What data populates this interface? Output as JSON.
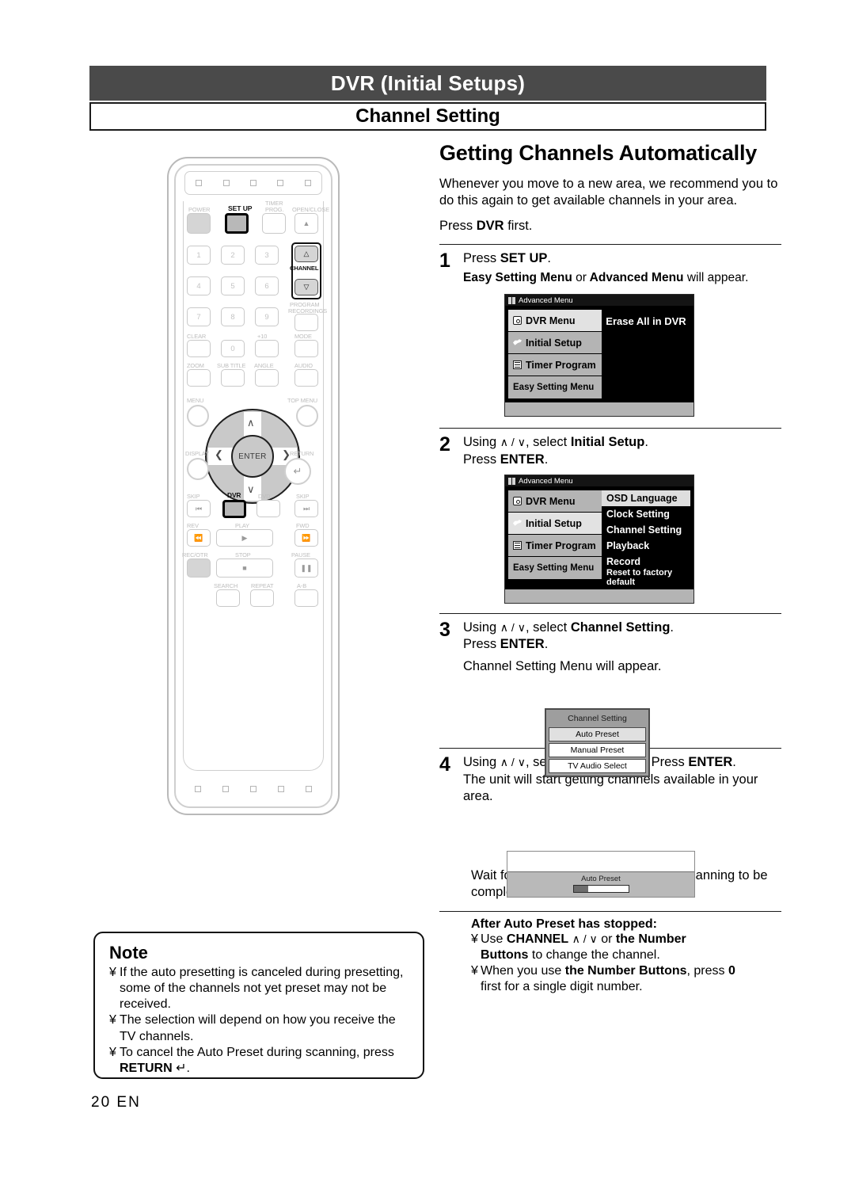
{
  "header": {
    "page_title": "DVR (Initial Setups)",
    "section_title": "Channel Setting"
  },
  "content": {
    "main_heading": "Getting Channels Automatically",
    "intro_1": "Whenever you move to a new area, we recommend you to do this again to get available channels in your area.",
    "intro_2_prefix": "Press ",
    "intro_2_bold": "DVR",
    "intro_2_suffix": " first.",
    "steps": [
      {
        "num": "1",
        "line1_pre": "Press ",
        "line1_bold": "SET UP",
        "line1_post": ".",
        "sub_a": "Easy Setting Menu",
        "sub_or": "or",
        "sub_b": "Advanced Menu",
        "sub_post": "will appear."
      },
      {
        "num": "2",
        "line1_pre": "Using ",
        "line1_keys": "∧ / ∨",
        "line1_mid": ", select ",
        "line1_bold": "Initial Setup",
        "line1_post": ".",
        "line2_pre": "Press ",
        "line2_bold": "ENTER",
        "line2_post": "."
      },
      {
        "num": "3",
        "line1_pre": "Using ",
        "line1_keys": "∧ / ∨",
        "line1_mid": ", select ",
        "line1_bold": "Channel Setting",
        "line1_post": ".",
        "line2_pre": "Press ",
        "line2_bold": "ENTER",
        "line2_post": ".",
        "line3": "Channel Setting Menu will appear."
      },
      {
        "num": "4",
        "line1_pre": "Using ",
        "line1_keys": "∧ / ∨",
        "line1_mid": ", select ",
        "line1_bold": "Auto Preset",
        "line1_mid2": ". Press ",
        "line1_bold2": "ENTER",
        "line1_post": ".",
        "line2": "The unit will start getting channels available in your area.",
        "line3": "Wait for several minutes for channel scanning to be completed."
      }
    ],
    "after": {
      "title": "After Auto Preset has stopped:",
      "b1_pre": "Use ",
      "b1_bold": "CHANNEL",
      "b1_keys": "∧ / ∨",
      "b1_mid": " or ",
      "b1_bold2": "the Number",
      "b1_bold3": "Buttons",
      "b1_post": " to change the channel.",
      "b2_pre": "When you use ",
      "b2_bold": "the Number Buttons",
      "b2_mid": ", press ",
      "b2_bold2": "0",
      "b2_post": "first for a single digit number."
    }
  },
  "osd_screens": {
    "advanced_menu_1": {
      "title": "Advanced Menu",
      "left_items": [
        {
          "label": "DVR Menu",
          "icon": "disc-icon",
          "selected": true
        },
        {
          "label": "Initial Setup",
          "icon": "wrench-icon",
          "selected": false
        },
        {
          "label": "Timer Program",
          "icon": "lines-icon",
          "selected": false
        },
        {
          "label": "Easy Setting Menu",
          "icon": "none",
          "selected": false
        }
      ],
      "right_items": [
        {
          "label": "Erase All in DVR",
          "selected": false
        }
      ]
    },
    "advanced_menu_2": {
      "title": "Advanced Menu",
      "left_items": [
        {
          "label": "DVR Menu",
          "icon": "disc-icon",
          "selected": false
        },
        {
          "label": "Initial Setup",
          "icon": "wrench-icon",
          "selected": true
        },
        {
          "label": "Timer Program",
          "icon": "lines-icon",
          "selected": false
        },
        {
          "label": "Easy Setting Menu",
          "icon": "none",
          "selected": false
        }
      ],
      "right_items": [
        {
          "label": "OSD Language",
          "selected": true
        },
        {
          "label": "Clock Setting",
          "selected": false
        },
        {
          "label": "Channel Setting",
          "selected": false
        },
        {
          "label": "Playback",
          "selected": false
        },
        {
          "label": "Record",
          "selected": false
        },
        {
          "label": "Reset to factory default",
          "selected": false
        }
      ]
    },
    "channel_setting_menu": {
      "title": "Channel Setting",
      "items": [
        {
          "label": "Auto Preset",
          "selected": true
        },
        {
          "label": "Manual Preset",
          "selected": false
        },
        {
          "label": "TV Audio Select",
          "selected": false
        }
      ]
    },
    "auto_preset_progress": {
      "label": "Auto Preset",
      "progress_percent": 25
    }
  },
  "note": {
    "title": "Note",
    "bullet_char": "¥",
    "items": [
      "If the auto presetting is canceled during presetting, some of the channels not yet preset may not be received.",
      "The selection will depend on how you receive the TV channels.",
      "To cancel the Auto Preset during scanning, press"
    ],
    "last_bold": "RETURN",
    "last_glyph": "↵",
    "last_post": "."
  },
  "footer": {
    "page_number": "20",
    "language": "EN"
  },
  "remote": {
    "labels": {
      "power": "POWER",
      "setup": "SET UP",
      "timer_prog_l1": "TIMER",
      "timer_prog_l2": "PROG.",
      "open_close": "OPEN/CLOSE",
      "channel": "CHANNEL",
      "program_rec_l1": "PROGRAM",
      "program_rec_l2": "RECORDINGS",
      "clear": "CLEAR",
      "plus10": "+10",
      "mode": "MODE",
      "zoom": "ZOOM",
      "subtitle": "SUB TITLE",
      "angle": "ANGLE",
      "audio": "AUDIO",
      "menu": "MENU",
      "top_menu": "TOP MENU",
      "display": "DISPLAY",
      "return": "RETURN",
      "enter": "ENTER",
      "skip_back": "SKIP",
      "dvr": "DVR",
      "dvd": "DVD",
      "skip_fwd": "SKIP",
      "rev": "REV",
      "play": "PLAY",
      "fwd": "FWD",
      "rec_otr": "REC/OTR",
      "stop": "STOP",
      "pause": "PAUSE",
      "search": "SEARCH",
      "repeat": "REPEAT",
      "ab": "A-B"
    },
    "numbers": [
      "1",
      "2",
      "3",
      "4",
      "5",
      "6",
      "7",
      "8",
      "9",
      "0"
    ],
    "highlighted_buttons": [
      "setup",
      "channel-up",
      "channel-down",
      "dvr"
    ]
  }
}
